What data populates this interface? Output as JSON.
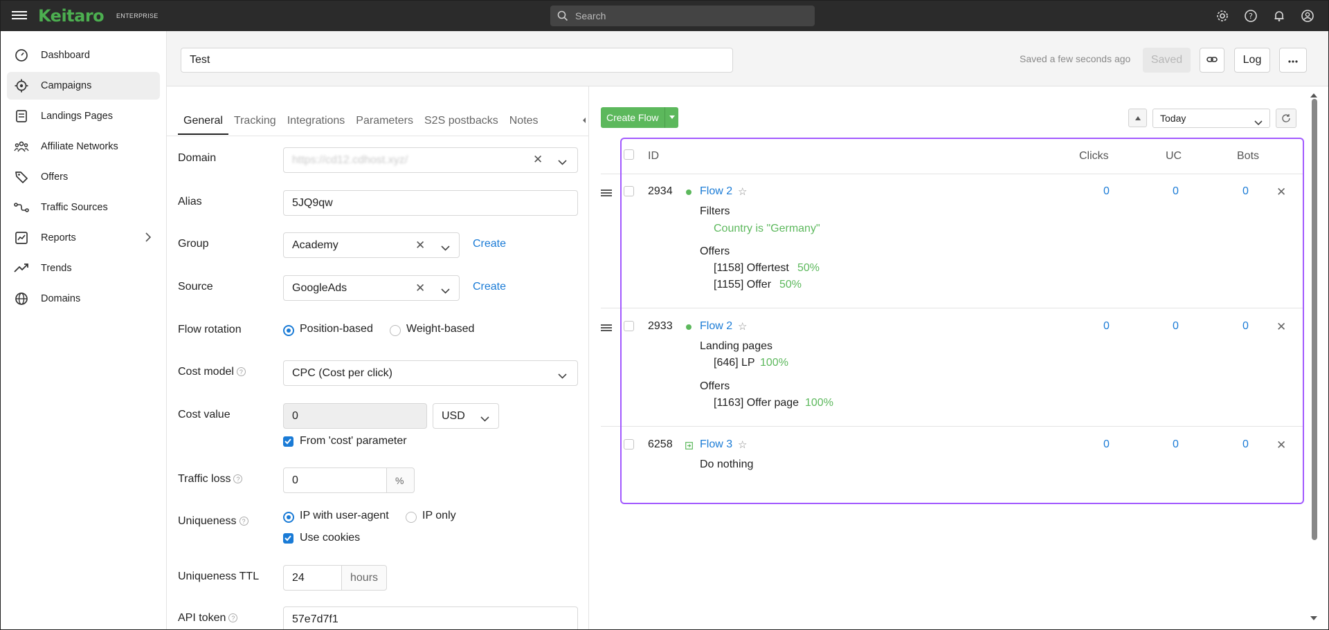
{
  "app": {
    "logo": "Keitaro",
    "edition": "ENTERPRISE",
    "search_placeholder": "Search"
  },
  "sidebar": {
    "items": [
      {
        "label": "Dashboard",
        "icon": "dashboard-icon"
      },
      {
        "label": "Campaigns",
        "icon": "target-icon",
        "active": true
      },
      {
        "label": "Landings Pages",
        "icon": "document-icon"
      },
      {
        "label": "Affiliate Networks",
        "icon": "people-icon"
      },
      {
        "label": "Offers",
        "icon": "tag-icon"
      },
      {
        "label": "Traffic Sources",
        "icon": "route-icon"
      },
      {
        "label": "Reports",
        "icon": "report-icon"
      },
      {
        "label": "Trends",
        "icon": "trend-icon"
      },
      {
        "label": "Domains",
        "icon": "globe-icon"
      }
    ]
  },
  "header": {
    "campaign_name": "Test",
    "saved_status": "Saved a few seconds ago",
    "saved_button": "Saved",
    "log_button": "Log"
  },
  "tabs": [
    "General",
    "Tracking",
    "Integrations",
    "Parameters",
    "S2S postbacks",
    "Notes"
  ],
  "form": {
    "domain_label": "Domain",
    "domain_value": "https://cd12.cdhost.xyz/",
    "alias_label": "Alias",
    "alias_value": "5JQ9qw",
    "group_label": "Group",
    "group_value": "Academy",
    "group_create": "Create",
    "source_label": "Source",
    "source_value": "GoogleAds",
    "source_create": "Create",
    "rotation_label": "Flow rotation",
    "rotation_position": "Position-based",
    "rotation_weight": "Weight-based",
    "cost_model_label": "Cost model",
    "cost_model_value": "CPC (Cost per click)",
    "cost_value_label": "Cost value",
    "cost_value": "0",
    "currency": "USD",
    "from_cost_label": "From 'cost' parameter",
    "traffic_loss_label": "Traffic loss",
    "traffic_loss_value": "0",
    "percent": "%",
    "uniqueness_label": "Uniqueness",
    "uniq_ip_ua": "IP with user-agent",
    "uniq_ip_only": "IP only",
    "use_cookies": "Use cookies",
    "ttl_label": "Uniqueness TTL",
    "ttl_value": "24",
    "ttl_unit": "hours",
    "api_token_label": "API token",
    "api_token_value": "57e7d7f1"
  },
  "flows_toolbar": {
    "create_flow": "Create Flow",
    "period": "Today"
  },
  "table": {
    "headers": {
      "id": "ID",
      "clicks": "Clicks",
      "uc": "UC",
      "bots": "Bots"
    },
    "rows": [
      {
        "id": "2934",
        "name": "Flow 2",
        "clicks": "0",
        "uc": "0",
        "bots": "0",
        "filters_title": "Filters",
        "filter": "Country is \"Germany\"",
        "offers_title": "Offers",
        "offer1": "[1158] Offertest",
        "offer1_pct": "50%",
        "offer2": "[1155] Offer",
        "offer2_pct": "50%"
      },
      {
        "id": "2933",
        "name": "Flow 2",
        "clicks": "0",
        "uc": "0",
        "bots": "0",
        "landings_title": "Landing pages",
        "landing1": "[646] LP",
        "landing1_pct": "100%",
        "offers_title": "Offers",
        "offer1": "[1163] Offer page",
        "offer1_pct": "100%"
      },
      {
        "id": "6258",
        "name": "Flow 3",
        "clicks": "0",
        "uc": "0",
        "bots": "0",
        "action": "Do nothing"
      }
    ]
  },
  "colors": {
    "brand": "#4caf50",
    "link": "#1a7bd6",
    "highlight": "#a259ff"
  }
}
